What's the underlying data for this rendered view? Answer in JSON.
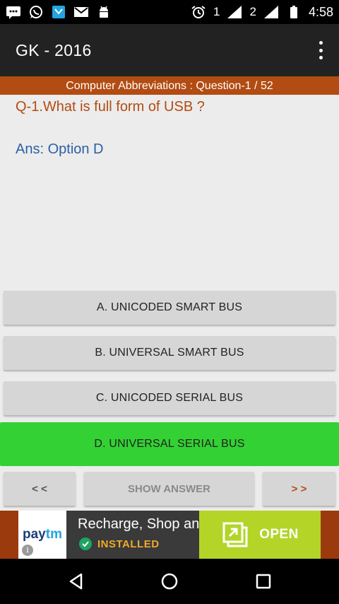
{
  "status_bar": {
    "left_icons": [
      "message-icon",
      "whatsapp-icon",
      "app-icon",
      "mail-icon",
      "android-icon"
    ],
    "sim1_label": "1",
    "sim2_label": "2",
    "time": "4:58"
  },
  "app_bar": {
    "title": "GK - 2016",
    "menu_icon": "more-vert-icon"
  },
  "quiz": {
    "header": "Computer Abbreviations : Question-1 / 52",
    "question": "Q-1.What is full form of USB ?",
    "answer": "Ans: Option D",
    "options": [
      {
        "label": "A. UNICODED SMART BUS",
        "correct": false
      },
      {
        "label": "B. UNIVERSAL SMART BUS",
        "correct": false
      },
      {
        "label": "C. UNICODED SERIAL BUS",
        "correct": false
      },
      {
        "label": "D. UNIVERSAL SERIAL BUS",
        "correct": true
      }
    ],
    "nav": {
      "prev": "< <",
      "show": "SHOW ANSWER",
      "next": "> >"
    }
  },
  "ad": {
    "brand_a": "pay",
    "brand_b": "tm",
    "info_glyph": "i",
    "headline": "Recharge, Shop and more",
    "status": "INSTALLED",
    "cta": "OPEN"
  },
  "colors": {
    "accent": "#b24c12",
    "answer": "#2b5fa5",
    "correct_option": "#33d133",
    "cta": "#b4d428"
  }
}
